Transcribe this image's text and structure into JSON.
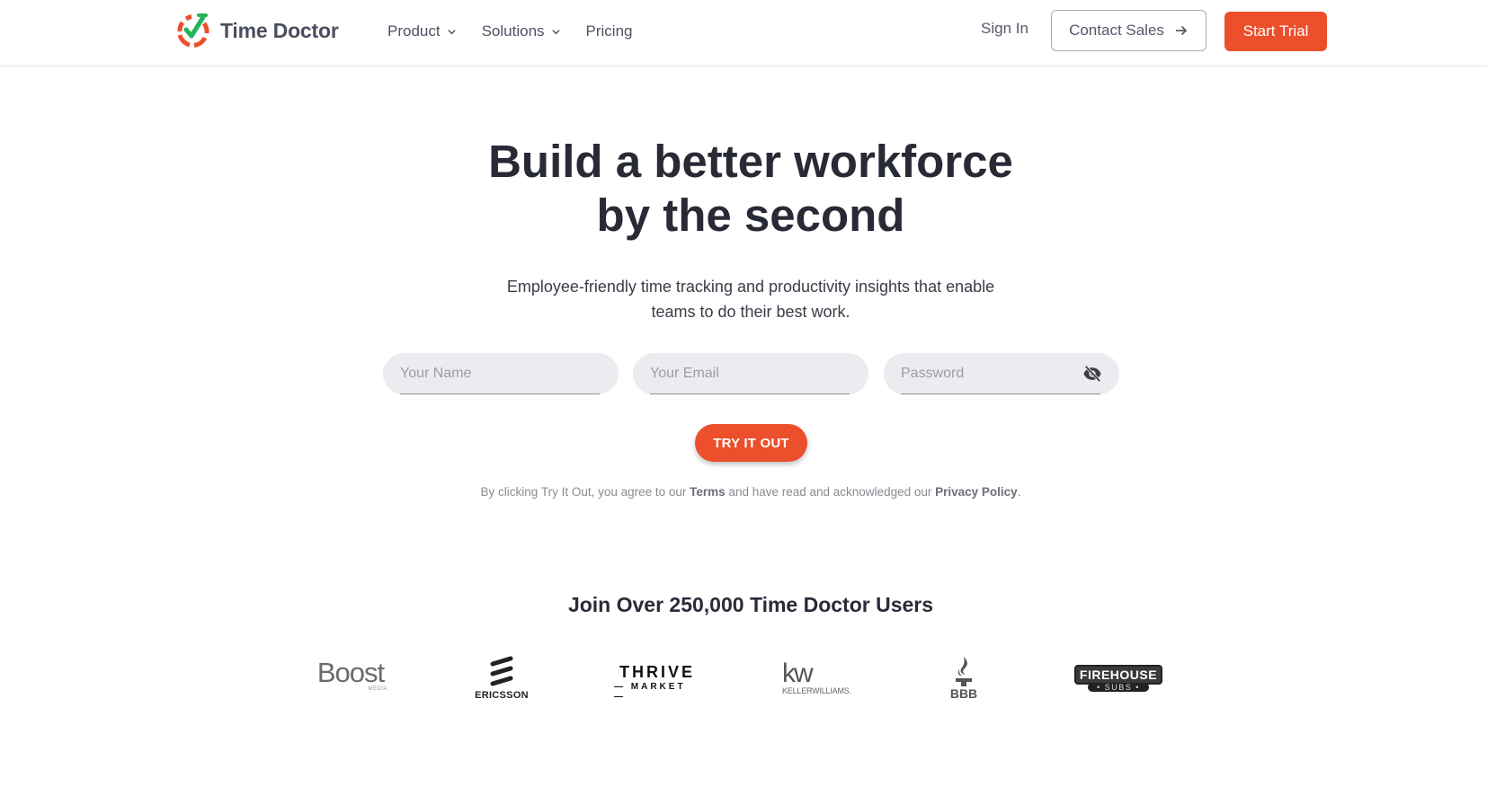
{
  "header": {
    "brand": "Time Doctor",
    "nav": [
      {
        "label": "Product",
        "has_dropdown": true
      },
      {
        "label": "Solutions",
        "has_dropdown": true
      },
      {
        "label": "Pricing",
        "has_dropdown": false
      }
    ],
    "sign_in": "Sign In",
    "contact_sales": "Contact Sales",
    "start_trial": "Start Trial"
  },
  "hero": {
    "headline_line1": "Build a better workforce",
    "headline_line2": "by the second",
    "subhead_line1": "Employee-friendly time tracking and productivity insights that enable",
    "subhead_line2": "teams to do their best work."
  },
  "form": {
    "name_placeholder": "Your Name",
    "name_value": "",
    "email_placeholder": "Your Email",
    "email_value": "",
    "password_placeholder": "Password",
    "password_value": "",
    "password_toggle_icon": "eye-off-icon",
    "submit_label": "TRY IT OUT"
  },
  "legal": {
    "prefix": "By clicking Try It Out, you agree to our ",
    "terms": "Terms",
    "middle": " and have read and acknowledged our ",
    "privacy": "Privacy Policy",
    "suffix": "."
  },
  "social_proof": {
    "heading": "Join Over 250,000 Time Doctor Users",
    "logos": [
      {
        "name": "Boost",
        "sub": "MEDIA"
      },
      {
        "name": "ERICSSON"
      },
      {
        "name": "THRIVE",
        "sub": "— MARKET —"
      },
      {
        "name": "kw",
        "sub": "KELLERWILLIAMS."
      },
      {
        "name": "BBB"
      },
      {
        "name": "FIREHOUSE",
        "sub": "• SUBS •"
      }
    ]
  },
  "colors": {
    "accent": "#ec4f2b",
    "logo_green": "#22b45a",
    "text_dark": "#282a36",
    "input_bg": "#ececf0"
  }
}
